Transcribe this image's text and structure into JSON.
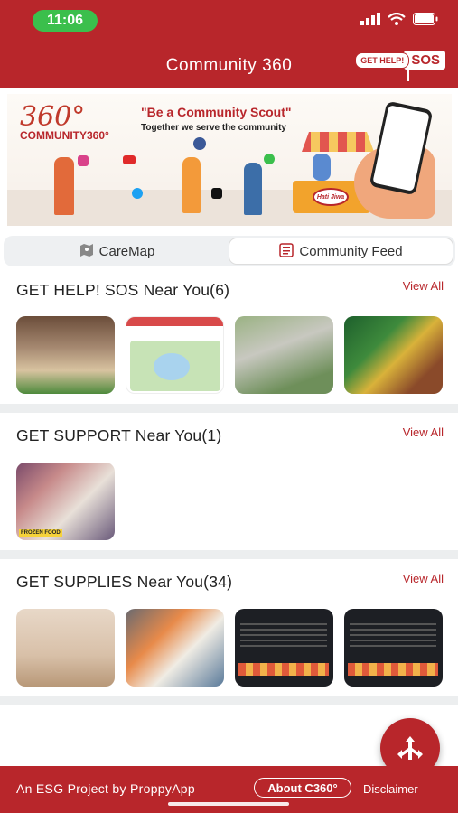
{
  "status_bar": {
    "time": "11:06"
  },
  "header": {
    "title": "Community 360",
    "gethelp_label": "GET HELP!",
    "sos_label": "SOS"
  },
  "banner": {
    "logo_number": "360°",
    "logo_text": "COMMUNITY360°",
    "slogan": "\"Be a Community Scout\"",
    "slogan_sub": "Together we serve the community",
    "stall_label": "Hati Jiwa"
  },
  "tabs": [
    {
      "label": "CareMap",
      "icon": "map-icon",
      "active": false
    },
    {
      "label": "Community Feed",
      "icon": "feed-icon",
      "active": true
    }
  ],
  "sections": [
    {
      "title": "GET HELP! SOS Near You(6)",
      "view_all": "View All"
    },
    {
      "title": "GET SUPPORT Near You(1)",
      "view_all": "View All"
    },
    {
      "title": "GET SUPPLIES Near You(34)",
      "view_all": "View All"
    }
  ],
  "support_tag": "FROZEN FOOD",
  "footer": {
    "project_text": "An ESG Project by ProppyApp",
    "about_label": "About C360°",
    "disclaimer": "Disclaimer"
  },
  "colors": {
    "brand": "#b8262b",
    "status_green": "#3bbf4c"
  }
}
